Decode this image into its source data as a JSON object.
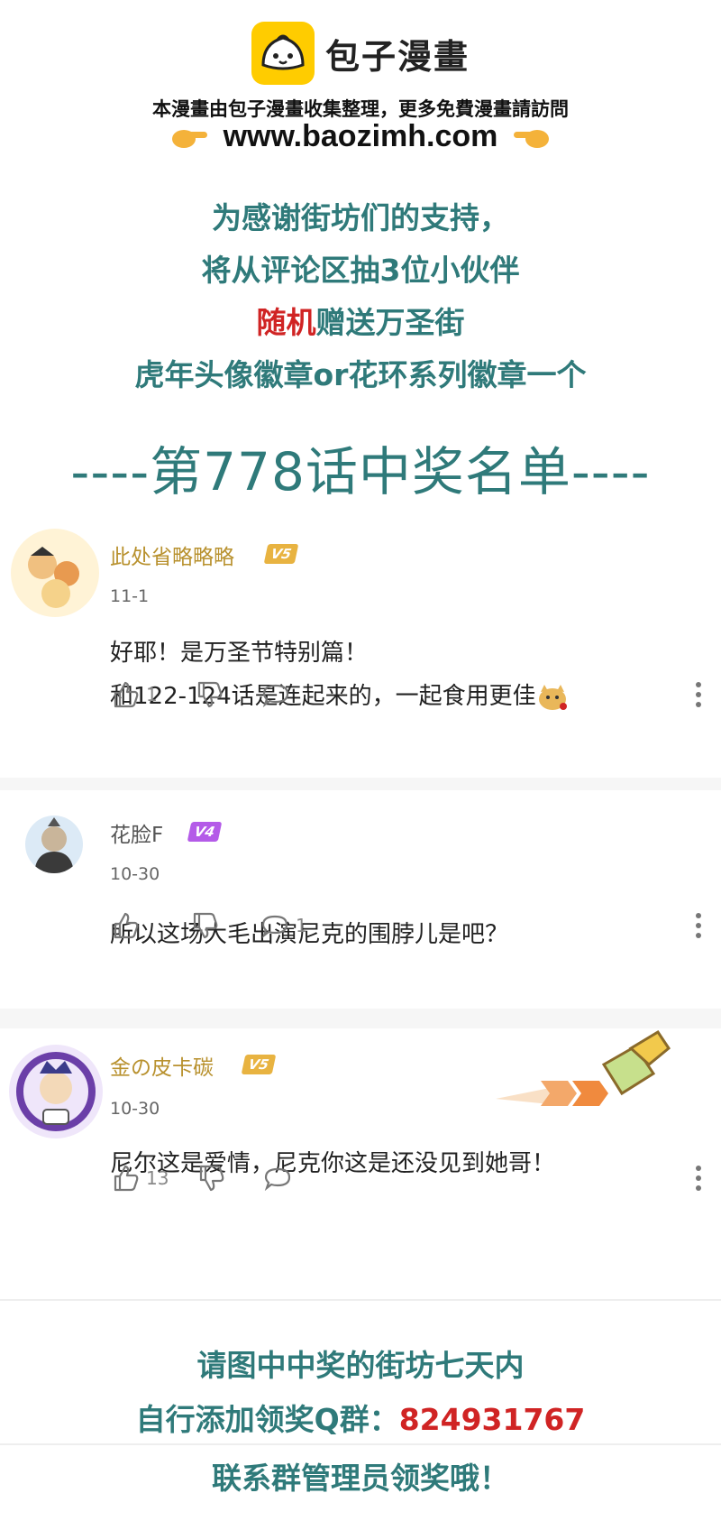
{
  "header": {
    "brand": "包子漫畫",
    "notice": "本漫畫由包子漫畫收集整理，更多免費漫畫請訪問",
    "url": "www.baozimh.com"
  },
  "promo": {
    "line1": "为感谢街坊们的支持，",
    "line2": "将从评论区抽3位小伙伴",
    "line3_red": "随机",
    "line3_rest": "赠送万圣街",
    "line4": "虎年头像徽章or花环系列徽章一个"
  },
  "winners_title": "----第778话中奖名单----",
  "comments": [
    {
      "username": "此处省略略略",
      "level": "V5",
      "date": "11-1",
      "lines": [
        "好耶！是万圣节特别篇！",
        "和122-124话是连起来的，一起食用更佳"
      ],
      "likes": "1",
      "replies": ""
    },
    {
      "username": "花脸F",
      "level": "V4",
      "date": "10-30",
      "lines": [
        "所以这场大毛出演尼克的围脖儿是吧？"
      ],
      "likes": "",
      "replies": "1"
    },
    {
      "username": "金の皮卡碳",
      "level": "V5",
      "date": "10-30",
      "lines": [
        "尼尔这是爱情，尼克你这是还没见到她哥！"
      ],
      "likes": "13",
      "replies": ""
    }
  ],
  "footer": {
    "line1": "请图中中奖的街坊七天内",
    "line2_prefix": "自行添加领奖Q群：",
    "line2_number": "824931767",
    "line3": "联系群管理员领奖哦！"
  },
  "colors": {
    "promo_teal": "#2f7a7a",
    "accent_red": "#d02424",
    "logo_yellow": "#ffcc00",
    "badge_v5": "#e8b341",
    "badge_v4": "#b45be8"
  }
}
